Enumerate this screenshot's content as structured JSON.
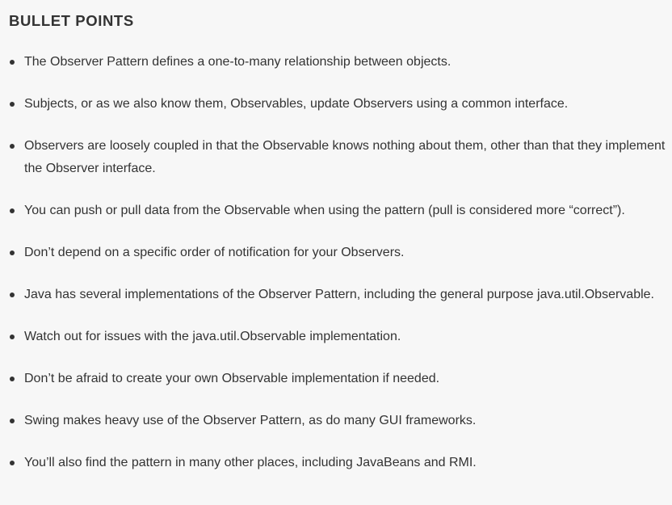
{
  "heading": "BULLET POINTS",
  "bullets": [
    "The Observer Pattern defines a one-to-many relationship between objects.",
    "Subjects, or as we also know them, Observables, update Observers using a common interface.",
    "Observers are loosely coupled in that the Observable knows nothing about them, other than that they implement the Observer interface.",
    "You can push or pull data from the Observable when using the pattern (pull is considered more “correct”).",
    "Don’t depend on a specific order of notification for your Observers.",
    "Java has several implementations of the Observer Pattern, including the general purpose java.util.Observable.",
    "Watch out for issues with the java.util.Observable implementation.",
    "Don’t be afraid to create your own Observable implementation if needed.",
    "Swing makes heavy use of the Observer Pattern, as do many GUI frameworks.",
    "You’ll also find the pattern in many other places, including JavaBeans and RMI."
  ]
}
